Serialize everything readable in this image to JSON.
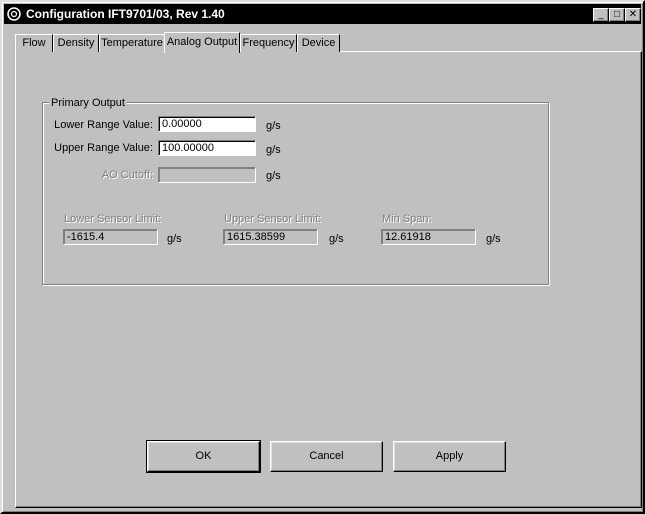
{
  "window": {
    "title": "Configuration IFT9701/03, Rev 1.40",
    "minimize_glyph": "_",
    "maximize_glyph": "□",
    "close_glyph": "✕"
  },
  "tabs": [
    {
      "label": "Flow"
    },
    {
      "label": "Density"
    },
    {
      "label": "Temperature"
    },
    {
      "label": "Analog Output"
    },
    {
      "label": "Frequency"
    },
    {
      "label": "Device"
    }
  ],
  "active_tab": "Analog Output",
  "primary_output": {
    "group_label": "Primary Output",
    "lower_range_label": "Lower Range Value:",
    "lower_range_value": "0.00000",
    "lower_range_unit": "g/s",
    "upper_range_label": "Upper Range Value:",
    "upper_range_value": "100.00000",
    "upper_range_unit": "g/s",
    "ao_cutoff_label": "AO Cutoff:",
    "ao_cutoff_value": "",
    "ao_cutoff_unit": "g/s",
    "lower_sensor_label": "Lower Sensor Limit:",
    "lower_sensor_value": "-1615.4",
    "lower_sensor_unit": "g/s",
    "upper_sensor_label": "Upper Sensor Limit:",
    "upper_sensor_value": "1615.38599",
    "upper_sensor_unit": "g/s",
    "min_span_label": "Min Span:",
    "min_span_value": "12.61918",
    "min_span_unit": "g/s"
  },
  "buttons": {
    "ok": "OK",
    "cancel": "Cancel",
    "apply": "Apply"
  }
}
